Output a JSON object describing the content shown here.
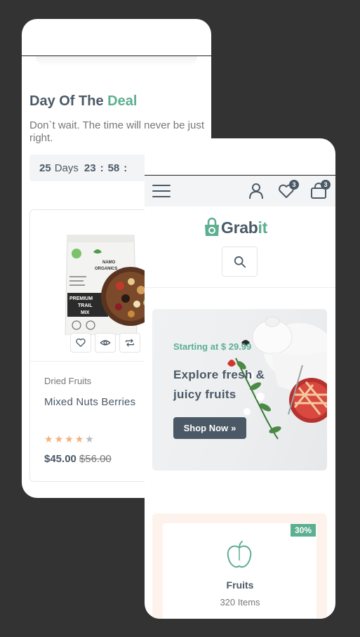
{
  "back_screen": {
    "deal": {
      "title_main": "Day Of The",
      "title_accent": "Deal",
      "subtitle": "Don`t wait. The time will never be just right."
    },
    "countdown": {
      "days": "25",
      "days_label": "Days",
      "hours": "23",
      "minutes": "58",
      "separator": ":"
    },
    "product": {
      "category": "Dried Fruits",
      "name": "Mixed Nuts Berries",
      "rating": 4,
      "rating_max": 5,
      "price": "$45.00",
      "old_price": "$56.00",
      "package": {
        "brand_line1": "NAMO",
        "brand_line2": "ORGANICS",
        "product_line1": "PREMIUM",
        "product_line2": "TRAIL",
        "product_line3": "MIX"
      },
      "actions": [
        "heart-icon",
        "eye-icon",
        "compare-icon"
      ]
    }
  },
  "front_screen": {
    "header": {
      "menu_icon": "hamburger-icon",
      "user_icon": "user-icon",
      "wishlist_count": "3",
      "cart_count": "3"
    },
    "logo": {
      "text_main": "Grab",
      "text_accent": "it"
    },
    "search_icon": "search-icon",
    "hero": {
      "small_text": "Starting at $ 29.99",
      "title": "Explore fresh & juicy fruits",
      "button_label": "Shop Now",
      "button_icon": "»"
    },
    "category": {
      "discount": "30%",
      "name": "Fruits",
      "count": "320 Items",
      "icon": "apple-icon"
    }
  },
  "colors": {
    "background": "#333333",
    "accent": "#5caf90",
    "text_dark": "#4b5966",
    "star_filled": "#f4b17a",
    "star_empty": "#bbbbbb"
  }
}
